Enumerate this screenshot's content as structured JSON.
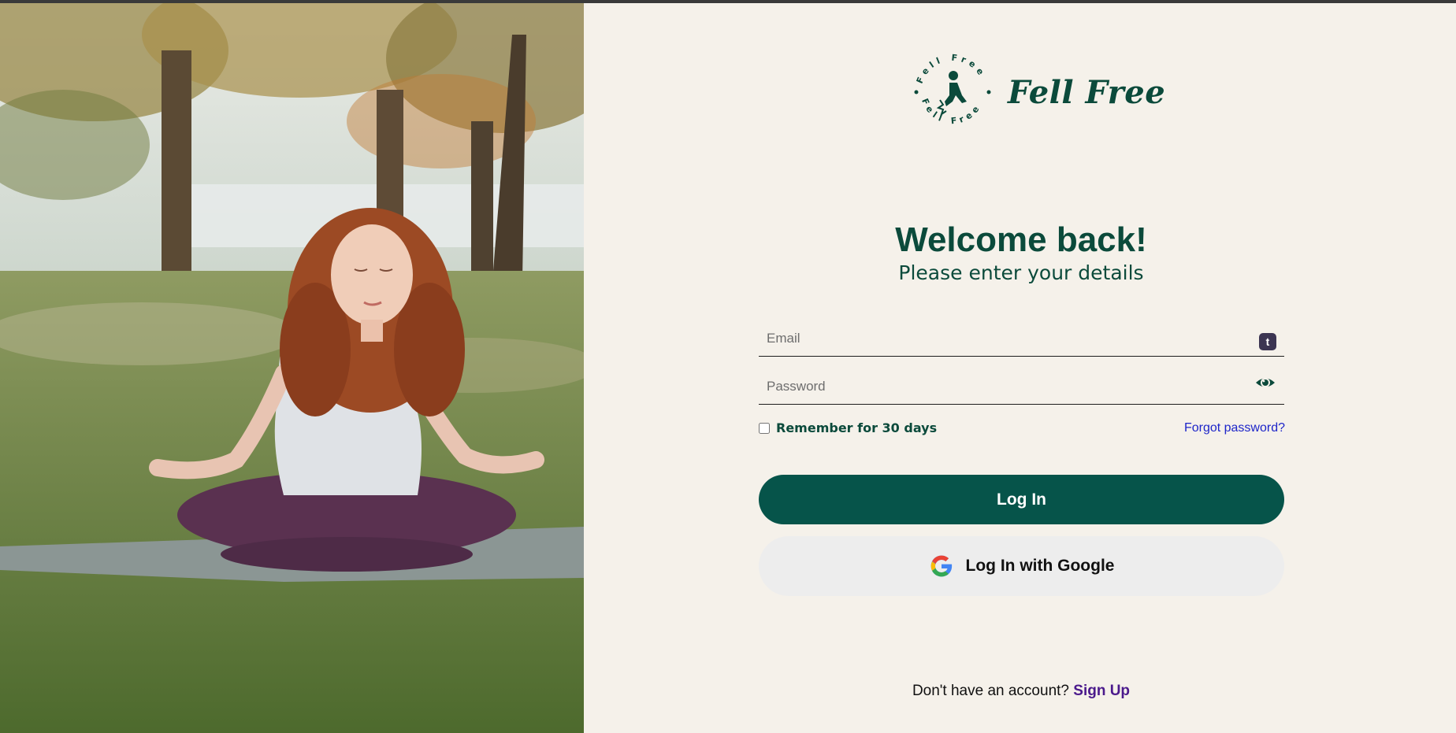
{
  "brand": {
    "name": "Fell Free",
    "ring_text": "Fell Free Fell Free"
  },
  "heading": "Welcome back!",
  "subheading": "Please enter your details",
  "email": {
    "placeholder": "Email",
    "value": "",
    "badge": "t"
  },
  "password": {
    "placeholder": "Password",
    "value": ""
  },
  "remember": {
    "label": "Remember for 30 days",
    "checked": false
  },
  "forgot_label": "Forgot password?",
  "login_label": "Log In",
  "google_label": "Log In with Google",
  "signup": {
    "prompt": "Don't have an account?",
    "link": "Sign Up"
  },
  "colors": {
    "primary": "#06544a",
    "background": "#f5f1ea",
    "link": "#1d25c9",
    "signup_link": "#4b1a8c"
  }
}
